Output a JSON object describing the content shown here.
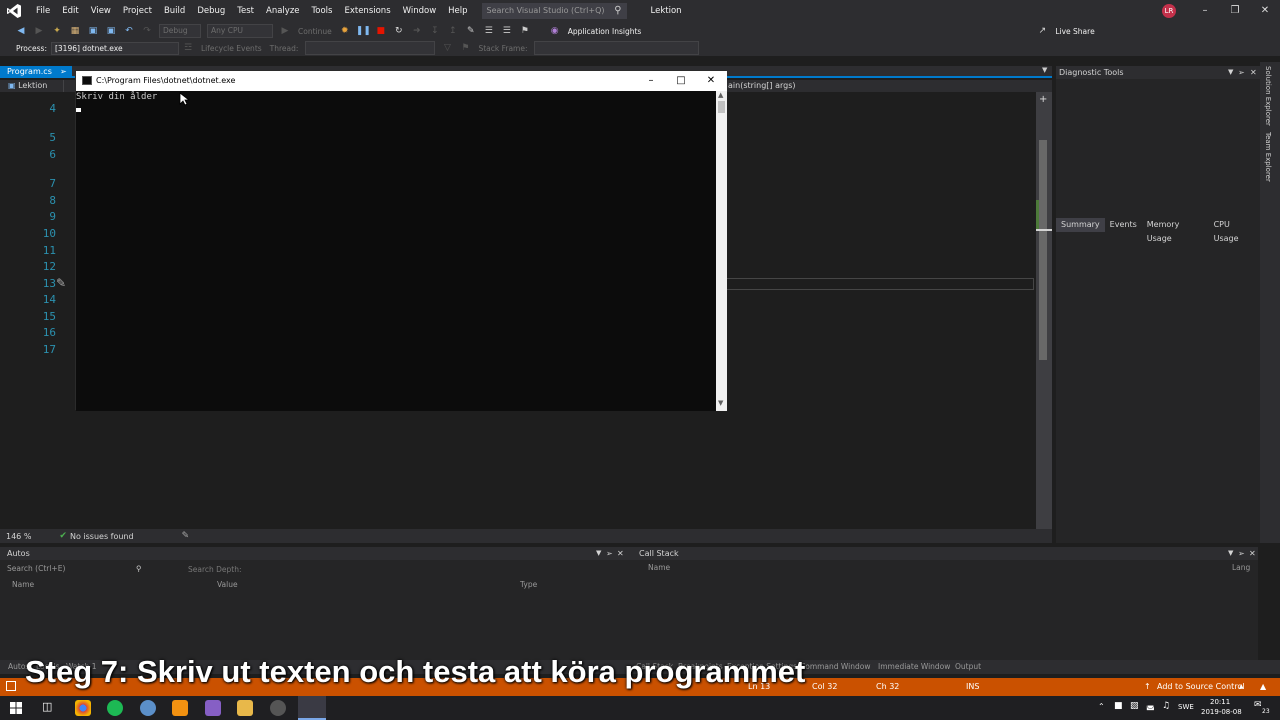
{
  "menubar": {
    "items": [
      "File",
      "Edit",
      "View",
      "Project",
      "Build",
      "Debug",
      "Test",
      "Analyze",
      "Tools",
      "Extensions",
      "Window",
      "Help"
    ],
    "search_placeholder": "Search Visual Studio (Ctrl+Q)",
    "solution_name": "Lektion",
    "avatar_initials": "LR"
  },
  "toolbar": {
    "config": "Debug",
    "platform": "Any CPU",
    "continue_label": "Continue",
    "app_insights": "Application Insights",
    "live_share": "Live Share"
  },
  "debugbar": {
    "process_label": "Process:",
    "process_value": "[3196] dotnet.exe",
    "lifecycle": "Lifecycle Events",
    "thread": "Thread:",
    "stack_frame": "Stack Frame:"
  },
  "editor": {
    "tab_label": "Program.cs",
    "nav_project": "Lektion",
    "nav_member": "ain(string[] args)",
    "line_numbers": [
      "4",
      "5",
      "6",
      "7",
      "8",
      "9",
      "10",
      "11",
      "12",
      "13",
      "14",
      "15",
      "16",
      "17"
    ],
    "zoom": "146 %",
    "issues": "No issues found"
  },
  "console": {
    "title": "C:\\Program Files\\dotnet\\dotnet.exe",
    "output": "Skriv din ålder"
  },
  "diagnostic": {
    "title": "Diagnostic Tools",
    "tabs": [
      "Summary",
      "Events",
      "Memory Usage",
      "CPU Usage"
    ]
  },
  "right_strip": {
    "solution_explorer": "Solution Explorer",
    "team_explorer": "Team Explorer"
  },
  "autos": {
    "title": "Autos",
    "search": "Search (Ctrl+E)",
    "search_depth": "Search Depth:",
    "col_name": "Name",
    "col_value": "Value",
    "col_type": "Type"
  },
  "callstack": {
    "title": "Call Stack",
    "col_name": "Name",
    "col_lang": "Lang"
  },
  "bottom_tabs": {
    "autos": "Autos",
    "locals": "Locals",
    "watch": "Watch 1",
    "call_stack": "Call Stack",
    "breakpoints": "Breakpoints",
    "exception": "Exception Settings",
    "command": "Command Window",
    "immediate": "Immediate Window",
    "output": "Output"
  },
  "statusbar": {
    "ln": "Ln 13",
    "col": "Col 32",
    "ch": "Ch 32",
    "ins": "INS",
    "source_control": "Add to Source Control"
  },
  "caption": "Steg 7: Skriv ut texten och testa att köra programmet",
  "taskbar": {
    "lang": "SWE",
    "time": "20:11",
    "date": "2019-08-08",
    "notif": "23"
  },
  "colors": {
    "accent": "#007acc",
    "statusbar": "#ca5100",
    "chrome": "#2d2d30",
    "editor_bg": "#1e1e1e"
  }
}
